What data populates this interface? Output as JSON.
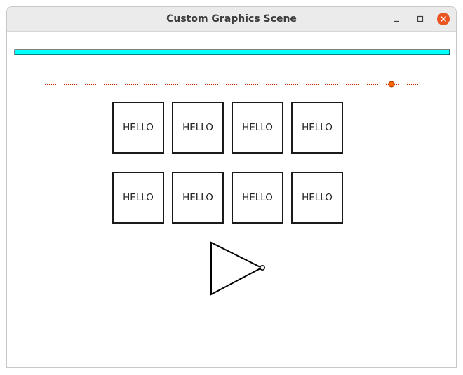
{
  "window": {
    "title": "Custom Graphics Scene",
    "controls": {
      "minimize_icon": "minimize-icon",
      "maximize_icon": "maximize-icon",
      "close_icon": "close-icon"
    }
  },
  "scene": {
    "progress_bar": {
      "fill_color": "#00ffff",
      "border_color": "#000000"
    },
    "dotted_line_color": "#cc2200",
    "slider_handle": {
      "fill_color": "#ff6600",
      "border_color": "#993300"
    },
    "hello_boxes": [
      {
        "label": "HELLO"
      },
      {
        "label": "HELLO"
      },
      {
        "label": "HELLO"
      },
      {
        "label": "HELLO"
      },
      {
        "label": "HELLO"
      },
      {
        "label": "HELLO"
      },
      {
        "label": "HELLO"
      },
      {
        "label": "HELLO"
      }
    ],
    "inverter_symbol": "not-gate-icon"
  },
  "colors": {
    "close_button": "#e95420",
    "titlebar": "#ebebeb"
  }
}
